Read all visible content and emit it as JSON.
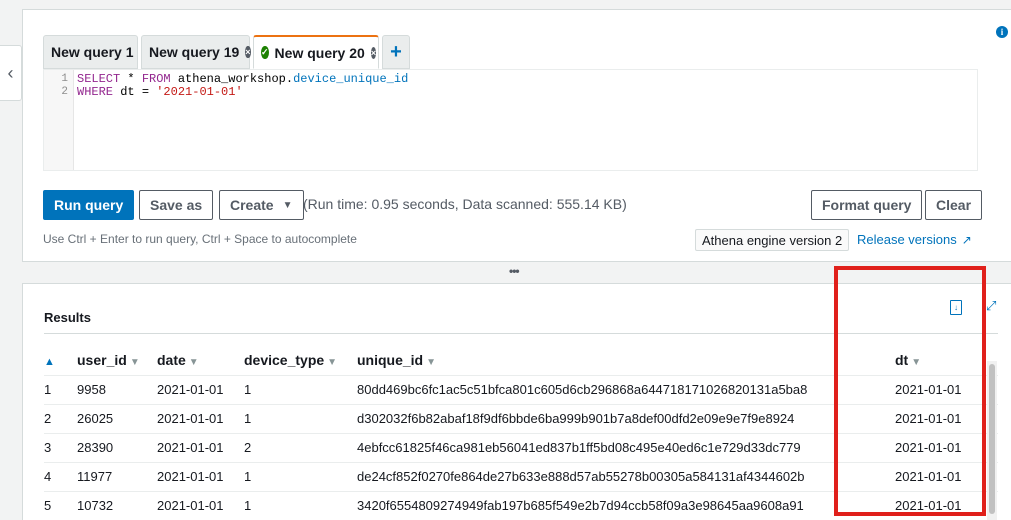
{
  "tabs": [
    {
      "label": "New query 1",
      "close": false,
      "status": "none"
    },
    {
      "label": "New query 19",
      "close": true,
      "status": "none"
    },
    {
      "label": "New query 20",
      "close": true,
      "status": "success",
      "active": true
    }
  ],
  "add_tab_label": "+",
  "editor": {
    "lines": [
      {
        "num": "1",
        "kw1": "SELECT",
        "text1": " * ",
        "kw2": "FROM",
        "text2": " athena_workshop.",
        "id": "device_unique_id"
      },
      {
        "num": "2",
        "kw1": "WHERE",
        "text1": " dt = ",
        "str": "'2021-01-01'"
      }
    ]
  },
  "toolbar": {
    "run_label": "Run query",
    "save_label": "Save as",
    "create_label": "Create",
    "format_label": "Format query",
    "clear_label": "Clear"
  },
  "run_info": "(Run time: 0.95 seconds, Data scanned: 555.14 KB)",
  "hint": "Use Ctrl + Enter to run query, Ctrl + Space to autocomplete",
  "engine_label": "Athena engine version 2",
  "release_label": "Release versions",
  "results": {
    "title": "Results",
    "columns": [
      "user_id",
      "date",
      "device_type",
      "unique_id",
      "dt"
    ],
    "rows": [
      {
        "n": "1",
        "user_id": "9958",
        "date": "2021-01-01",
        "device_type": "1",
        "unique_id": "80dd469bc6fc1ac5c51bfca801c605d6cb296868a644718171026820131a5ba8",
        "dt": "2021-01-01"
      },
      {
        "n": "2",
        "user_id": "26025",
        "date": "2021-01-01",
        "device_type": "1",
        "unique_id": "d302032f6b82abaf18f9df6bbde6ba999b901b7a8def00dfd2e09e9e7f9e8924",
        "dt": "2021-01-01"
      },
      {
        "n": "3",
        "user_id": "28390",
        "date": "2021-01-01",
        "device_type": "2",
        "unique_id": "4ebfcc61825f46ca981eb56041ed837b1ff5bd08c495e40ed6c1e729d33dc779",
        "dt": "2021-01-01"
      },
      {
        "n": "4",
        "user_id": "11977",
        "date": "2021-01-01",
        "device_type": "1",
        "unique_id": "de24cf852f0270fe864de27b633e888d57ab55278b00305a584131af4344602b",
        "dt": "2021-01-01"
      },
      {
        "n": "5",
        "user_id": "10732",
        "date": "2021-01-01",
        "device_type": "1",
        "unique_id": "3420f6554809274949fab197b685f549e2b7d94ccb58f09a3e98645aa9608a91",
        "dt": "2021-01-01"
      }
    ]
  },
  "colors": {
    "accent": "#0073bb",
    "tab_active": "#ec7211",
    "highlight": "#e0201b"
  }
}
